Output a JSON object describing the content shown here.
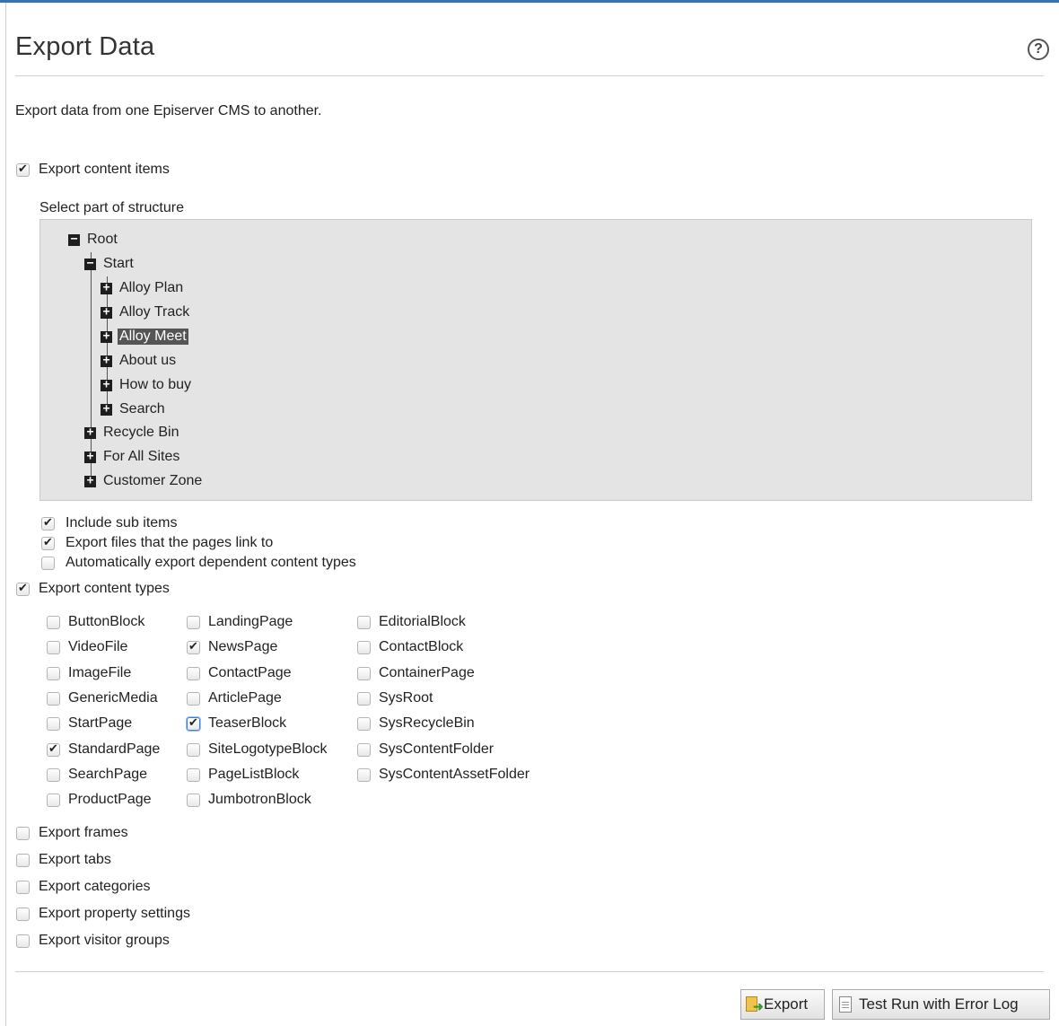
{
  "page": {
    "title": "Export Data",
    "description": "Export data from one Episerver CMS to another."
  },
  "help_icon": {
    "icon": "question-circle-icon",
    "glyph": "?"
  },
  "export_content_items": {
    "label": "Export content items",
    "checked": true
  },
  "structure": {
    "label": "Select part of structure",
    "tree": {
      "root": "Root",
      "start": "Start",
      "start_children": [
        "Alloy Plan",
        "Alloy Track",
        "Alloy Meet",
        "About us",
        "How to buy",
        "Search"
      ],
      "selected": "Alloy Meet",
      "root_children": [
        "Recycle Bin",
        "For All Sites",
        "Customer Zone"
      ]
    }
  },
  "sub_options": [
    {
      "label": "Include sub items",
      "checked": true
    },
    {
      "label": "Export files that the pages link to",
      "checked": true
    },
    {
      "label": "Automatically export dependent content types",
      "checked": false
    }
  ],
  "export_content_types": {
    "label": "Export content types",
    "checked": true
  },
  "content_types": {
    "col1": [
      {
        "label": "ButtonBlock",
        "checked": false
      },
      {
        "label": "VideoFile",
        "checked": false
      },
      {
        "label": "ImageFile",
        "checked": false
      },
      {
        "label": "GenericMedia",
        "checked": false
      },
      {
        "label": "StartPage",
        "checked": false
      },
      {
        "label": "StandardPage",
        "checked": true
      },
      {
        "label": "SearchPage",
        "checked": false
      },
      {
        "label": "ProductPage",
        "checked": false
      }
    ],
    "col2": [
      {
        "label": "LandingPage",
        "checked": false
      },
      {
        "label": "NewsPage",
        "checked": true
      },
      {
        "label": "ContactPage",
        "checked": false
      },
      {
        "label": "ArticlePage",
        "checked": false
      },
      {
        "label": "TeaserBlock",
        "checked": true
      },
      {
        "label": "SiteLogotypeBlock",
        "checked": false
      },
      {
        "label": "PageListBlock",
        "checked": false
      },
      {
        "label": "JumbotronBlock",
        "checked": false
      }
    ],
    "col3": [
      {
        "label": "EditorialBlock",
        "checked": false
      },
      {
        "label": "ContactBlock",
        "checked": false
      },
      {
        "label": "ContainerPage",
        "checked": false
      },
      {
        "label": "SysRoot",
        "checked": false
      },
      {
        "label": "SysRecycleBin",
        "checked": false
      },
      {
        "label": "SysContentFolder",
        "checked": false
      },
      {
        "label": "SysContentAssetFolder",
        "checked": false
      }
    ]
  },
  "other_exports": [
    {
      "label": "Export frames",
      "checked": false
    },
    {
      "label": "Export tabs",
      "checked": false
    },
    {
      "label": "Export categories",
      "checked": false
    },
    {
      "label": "Export property settings",
      "checked": false
    },
    {
      "label": "Export visitor groups",
      "checked": false
    }
  ],
  "buttons": {
    "export": {
      "label": "Export",
      "icon": "export-icon"
    },
    "test_run": {
      "label": "Test Run with Error Log",
      "icon": "document-icon"
    }
  }
}
